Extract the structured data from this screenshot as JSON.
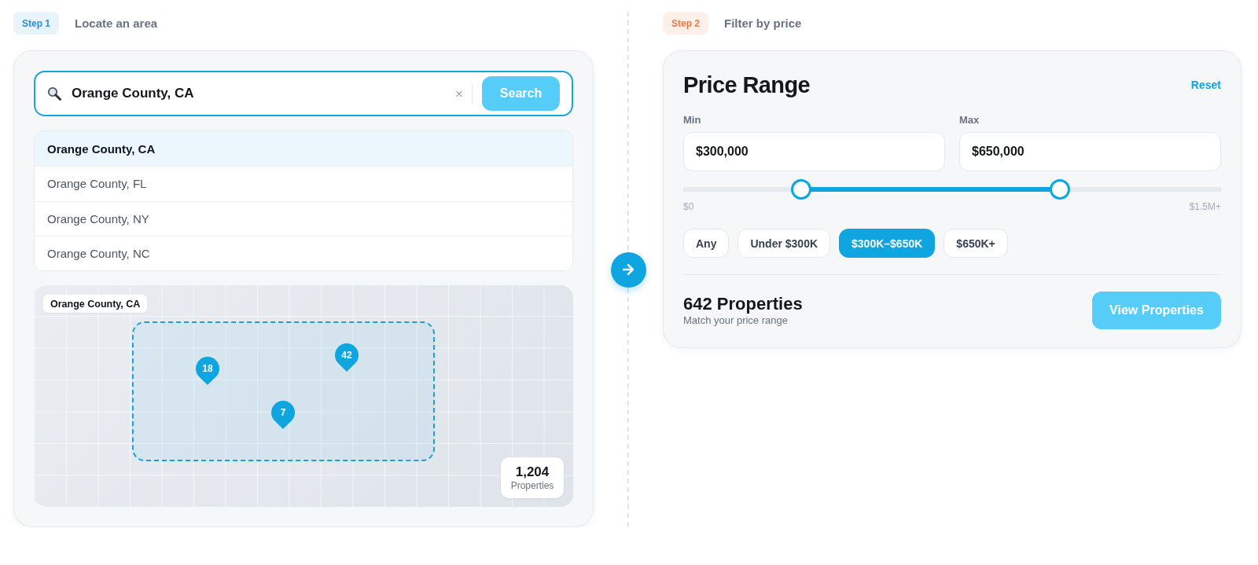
{
  "steps": [
    {
      "badge": "Step 1",
      "title": "Locate an area",
      "color": "#2a8fd4"
    },
    {
      "badge": "Step 2",
      "title": "Filter by price",
      "color": "#ef7b3d"
    }
  ],
  "search": {
    "value": "Orange County, CA",
    "clear": "×",
    "button": "Search"
  },
  "suggestions": [
    {
      "label": "Orange County, CA",
      "selected": true
    },
    {
      "label": "Orange County, FL",
      "selected": false
    },
    {
      "label": "Orange County, NY",
      "selected": false
    },
    {
      "label": "Orange County, NC",
      "selected": false
    }
  ],
  "map": {
    "area_label": "Orange County, CA",
    "pins": [
      {
        "count": "18"
      },
      {
        "count": "42"
      },
      {
        "count": "7"
      }
    ],
    "total": "1,204",
    "total_label": "Properties"
  },
  "price_range": {
    "title": "Price Range",
    "reset": "Reset",
    "min": {
      "label": "Min",
      "value": "$300,000"
    },
    "max": {
      "label": "Max",
      "value": "$650,000"
    },
    "slider": {
      "thumbs": [
        {
          "level": 0.22
        },
        {
          "level": 0.7
        }
      ]
    },
    "scale_min": "$0",
    "scale_max": "$1.5M+",
    "presets": [
      {
        "label": "Any",
        "selected": false
      },
      {
        "label": "Under $300K",
        "selected": false
      },
      {
        "label": "$300K–$650K",
        "selected": true
      },
      {
        "label": "$650K+",
        "selected": false
      }
    ],
    "result": {
      "count": "642 Properties",
      "caption": "Match your price range"
    },
    "action": "View Properties"
  }
}
